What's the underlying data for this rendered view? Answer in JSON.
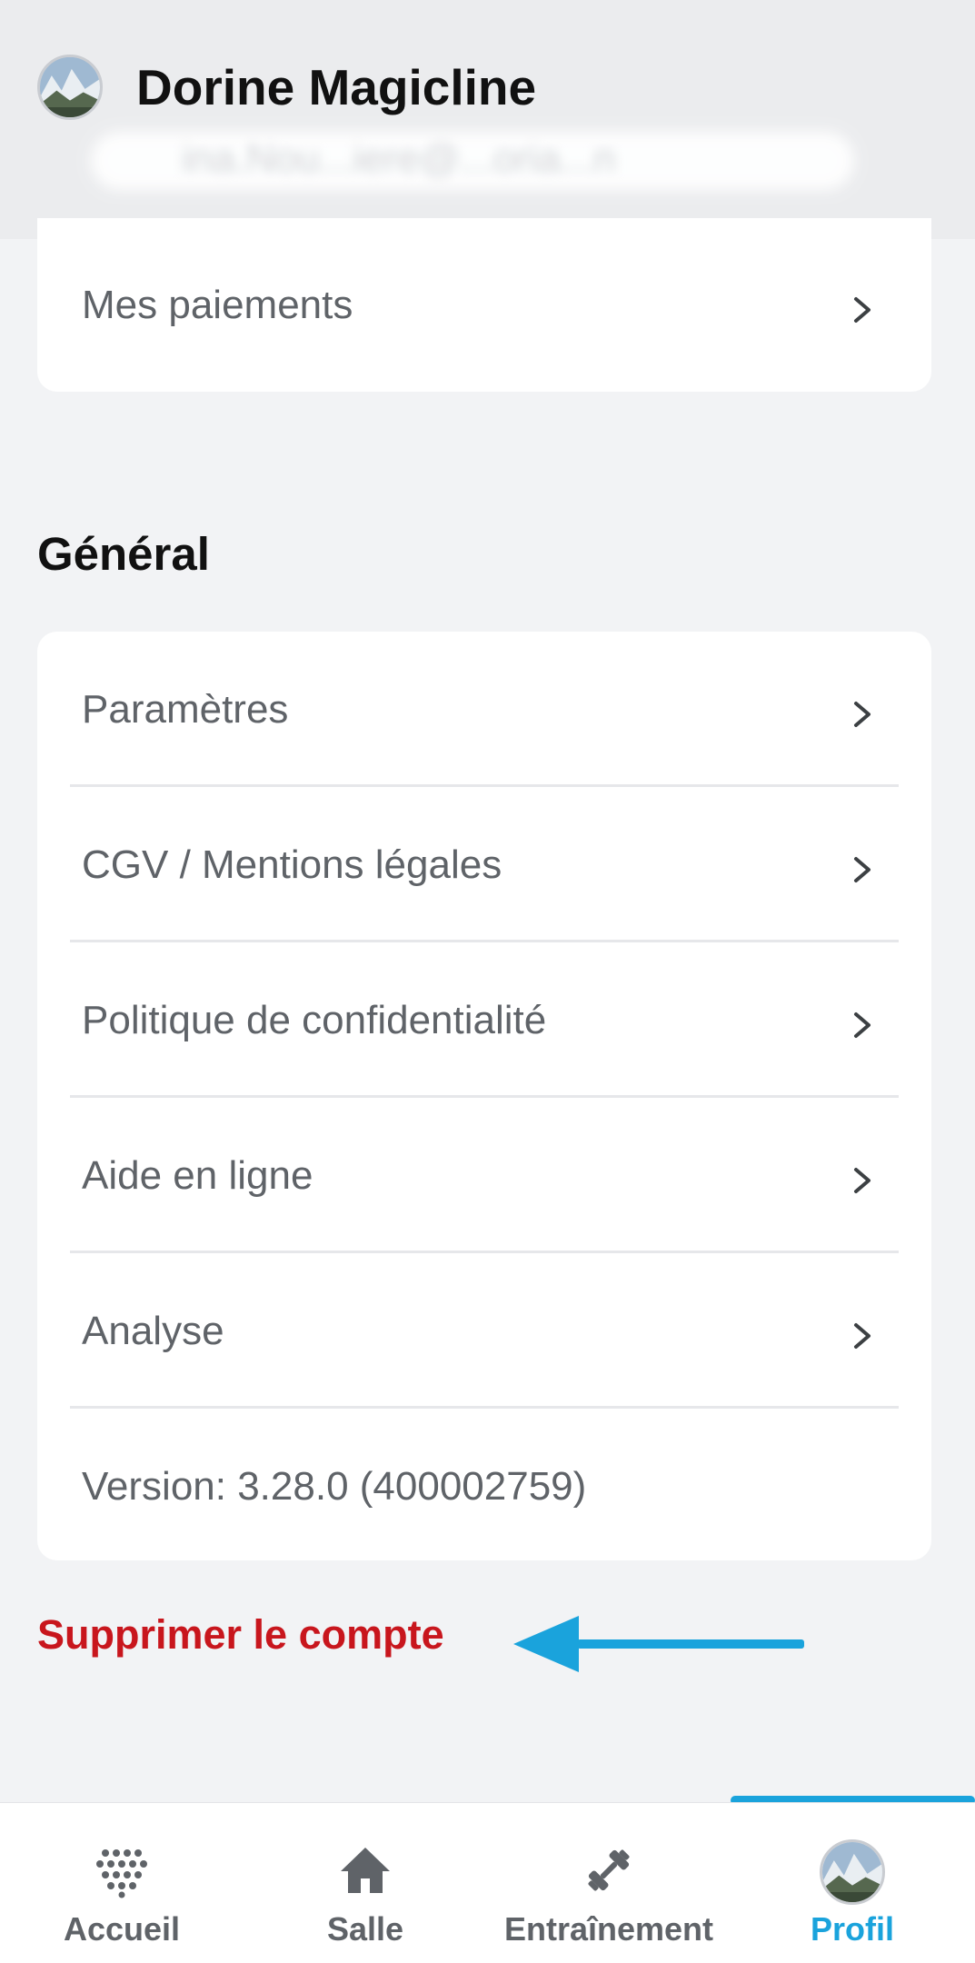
{
  "header": {
    "user_name": "Dorine Magicline",
    "email": "ina.Nou...iere@...oria...n"
  },
  "account_card": {
    "items": [
      {
        "label": "Mes paiements"
      }
    ]
  },
  "general": {
    "title": "Général",
    "items": [
      {
        "label": "Paramètres"
      },
      {
        "label": "CGV / Mentions légales"
      },
      {
        "label": "Politique de confidentialité"
      },
      {
        "label": "Aide en ligne"
      },
      {
        "label": "Analyse"
      }
    ],
    "version": "Version: 3.28.0  (400002759)"
  },
  "delete_account": {
    "label": "Supprimer le compte",
    "color": "#c8161d"
  },
  "annotation": {
    "arrow_color": "#1aa3dc"
  },
  "bottom_nav": {
    "items": [
      {
        "label": "Accueil",
        "icon": "grid-dots-icon"
      },
      {
        "label": "Salle",
        "icon": "home-icon"
      },
      {
        "label": "Entraînement",
        "icon": "dumbbell-icon"
      },
      {
        "label": "Profil",
        "icon": "avatar-icon",
        "active": true
      }
    ],
    "active_color": "#1aa3dc"
  }
}
